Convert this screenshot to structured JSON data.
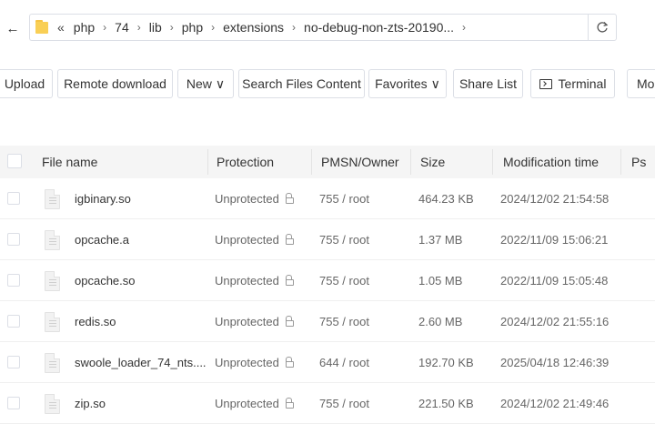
{
  "address_bar": {
    "back_glyph": "←",
    "double_chevron": "«",
    "crumbs": [
      "php",
      "74",
      "lib",
      "php",
      "extensions",
      "no-debug-non-zts-20190..."
    ],
    "separator": "›",
    "refresh_glyph": "↻"
  },
  "toolbar": {
    "upload": "Upload",
    "remote_download": "Remote download",
    "new": "New",
    "search_files_content": "Search Files Content",
    "favorites": "Favorites",
    "share_list": "Share List",
    "terminal": "Terminal",
    "more": "Mo",
    "caret": "∨"
  },
  "table": {
    "headers": {
      "file_name": "File name",
      "protection": "Protection",
      "pmsn_owner": "PMSN/Owner",
      "size": "Size",
      "modification_time": "Modification time",
      "ps": "Ps"
    },
    "rows": [
      {
        "name": "igbinary.so",
        "protection": "Unprotected",
        "pmsn": "755 / root",
        "size": "464.23 KB",
        "mtime": "2024/12/02 21:54:58"
      },
      {
        "name": "opcache.a",
        "protection": "Unprotected",
        "pmsn": "755 / root",
        "size": "1.37 MB",
        "mtime": "2022/11/09 15:06:21"
      },
      {
        "name": "opcache.so",
        "protection": "Unprotected",
        "pmsn": "755 / root",
        "size": "1.05 MB",
        "mtime": "2022/11/09 15:05:48"
      },
      {
        "name": "redis.so",
        "protection": "Unprotected",
        "pmsn": "755 / root",
        "size": "2.60 MB",
        "mtime": "2024/12/02 21:55:16"
      },
      {
        "name": "swoole_loader_74_nts....",
        "protection": "Unprotected",
        "pmsn": "644 / root",
        "size": "192.70 KB",
        "mtime": "2025/04/18 12:46:39"
      },
      {
        "name": "zip.so",
        "protection": "Unprotected",
        "pmsn": "755 / root",
        "size": "221.50 KB",
        "mtime": "2024/12/02 21:49:46"
      }
    ]
  },
  "colors": {
    "folder": "#f9cf55",
    "border": "#dcdfe6",
    "header_bg": "#f5f5f5"
  }
}
